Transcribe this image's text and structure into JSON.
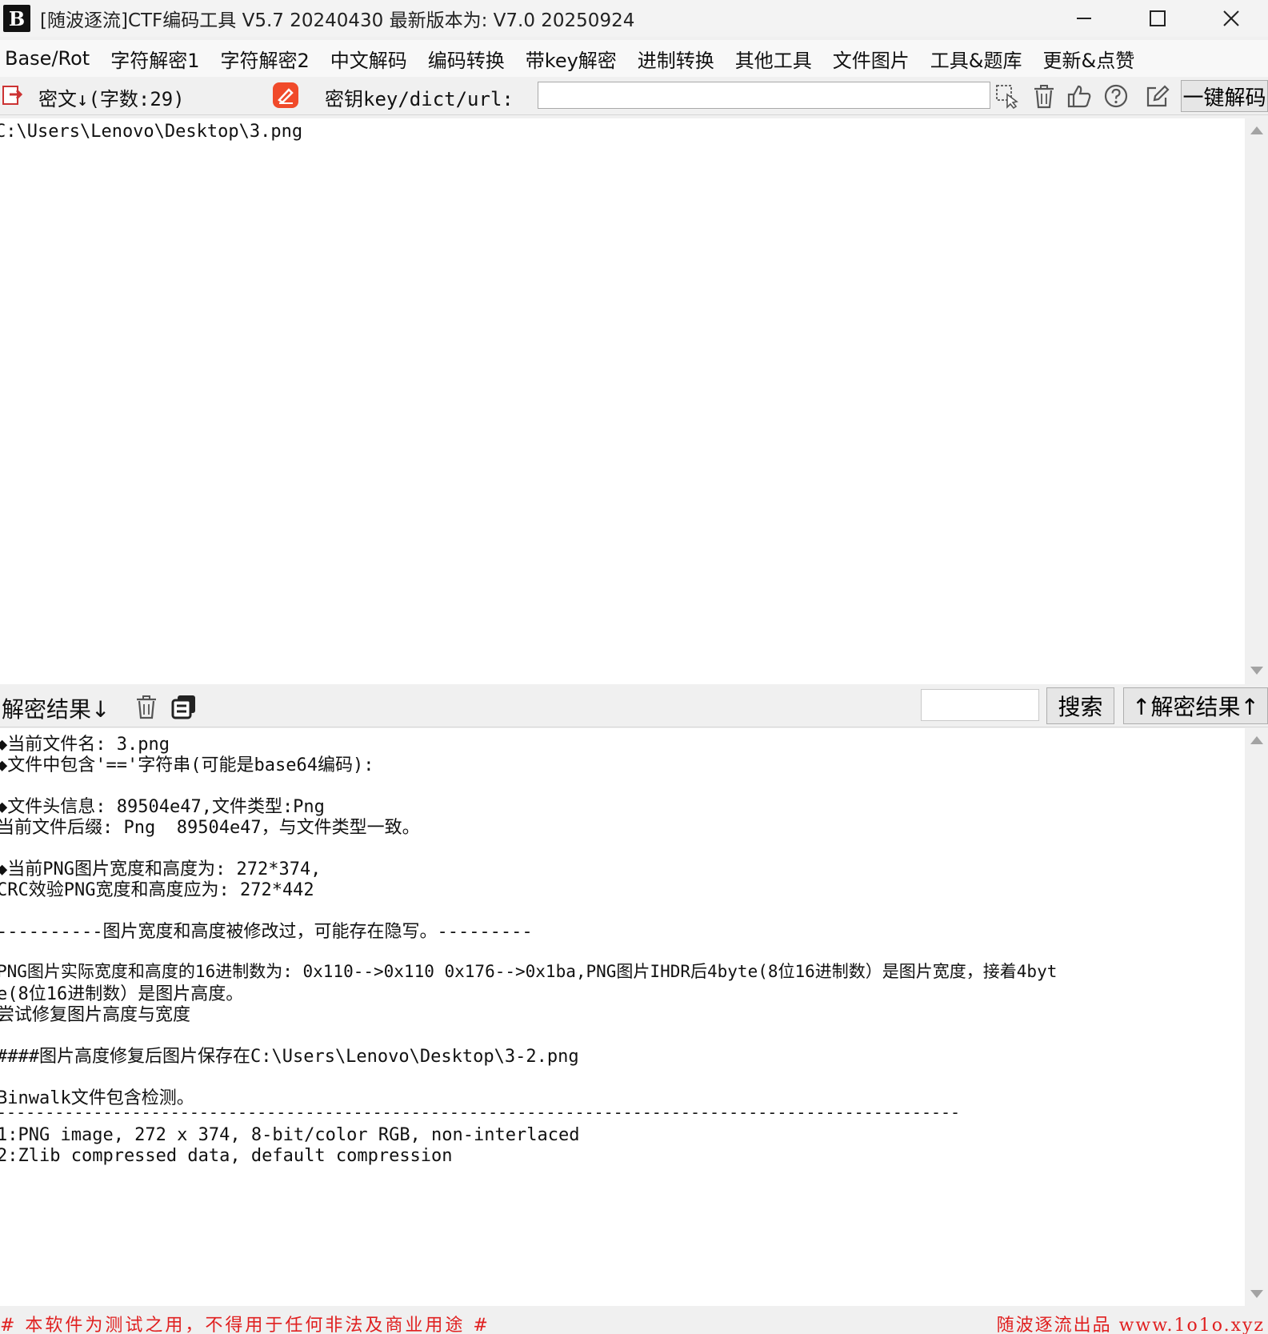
{
  "window": {
    "icon_text": "B",
    "title": "[随波逐流]CTF编码工具 V5.7 20240430    最新版本为: V7.0 20250924"
  },
  "menu": [
    "Base/Rot",
    "字符解密1",
    "字符解密2",
    "中文解码",
    "编码转换",
    "带key解密",
    "进制转换",
    "其他工具",
    "文件图片",
    "工具&题库",
    "更新&点赞"
  ],
  "toolbar": {
    "cipher_label": "密文↓(字数:29)",
    "key_label": "密钥key/dict/url:",
    "key_value": "",
    "decode_button": "一键解码"
  },
  "cipher": {
    "text": "C:\\Users\\Lenovo\\Desktop\\3.png"
  },
  "result_bar": {
    "label": "解密结果↓",
    "search_value": "",
    "search_button": "搜索",
    "up_button": "↑解密结果↑"
  },
  "result": {
    "lines": [
      "◆当前文件名: 3.png",
      "◆文件中包含'=='字符串(可能是base64编码):",
      "◆文件头信息: 89504e47,文件类型:Png",
      "当前文件后缀: Png  89504e47，与文件类型一致。",
      "◆当前PNG图片宽度和高度为: 272*374,",
      "CRC效验PNG宽度和高度应为: 272*442",
      "----------图片宽度和高度被修改过，可能存在隐写。---------",
      "PNG图片实际宽度和高度的16进制数为: 0x110-->0x110 0x176-->0x1ba,PNG图片IHDR后4byte(8位16进制数）是图片宽度，接着4byt",
      "e(8位16进制数）是图片高度。",
      "尝试修复图片高度与宽度",
      "####图片高度修复后图片保存在C:\\Users\\Lenovo\\Desktop\\3-2.png",
      "Binwalk文件包含检测。",
      "----------------------------------------------------------------------------------------------------",
      "1:PNG image, 272 x 374, 8-bit/color RGB, non-interlaced",
      "2:Zlib compressed data, default compression"
    ]
  },
  "status": {
    "left": "# 本软件为测试之用，不得用于任何非法及商业用途 #",
    "right": "随波逐流出品 www.1o1o.xyz"
  },
  "colors": {
    "accent_red": "#e02020",
    "text": "#111111"
  },
  "icons": [
    "app-logo",
    "minimize-icon",
    "maximize-icon",
    "close-icon",
    "import-icon",
    "eraser-icon",
    "select-cursor-icon",
    "trash-icon",
    "thumbs-up-icon",
    "help-icon",
    "edit-icon",
    "copy-icon"
  ]
}
